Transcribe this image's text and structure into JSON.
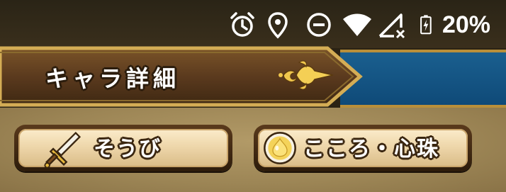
{
  "status_bar": {
    "battery_percent": "20%",
    "icons": [
      "alarm-icon",
      "location-icon",
      "do-not-disturb-icon",
      "wifi-icon",
      "cellular-no-signal-icon",
      "battery-charging-icon"
    ]
  },
  "header": {
    "title": "キャラ詳細",
    "ornament_icon": "fleur-ornament-icon"
  },
  "tabs": [
    {
      "label": "そうび",
      "icon": "sword-icon"
    },
    {
      "label": "こころ・心珠",
      "icon": "slime-orb-icon"
    }
  ],
  "colors": {
    "banner_brown": "#5b3a1e",
    "gold_trim": "#c8a04a",
    "blue_band": "#125585",
    "button_face": "#f3dfb6"
  }
}
